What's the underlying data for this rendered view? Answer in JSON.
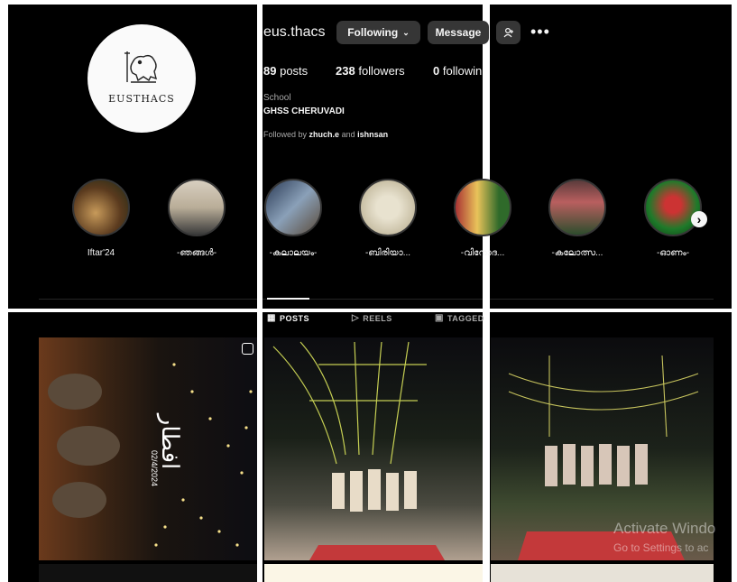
{
  "profile": {
    "username": "eus.thacs",
    "avatar_text": "EUSTHACS",
    "following_label": "Following",
    "message_label": "Message",
    "posts_count": "89",
    "posts_label": "posts",
    "followers_count": "238",
    "followers_label": "followers",
    "following_count": "0",
    "following_stat_label": "followin",
    "category": "School",
    "bio": "GHSS CHERUVADI",
    "followed_by_prefix": "Followed by",
    "followed_by_1": "zhuch.e",
    "followed_by_and": "and",
    "followed_by_2": "ishnsan"
  },
  "highlights": [
    {
      "label": "Iftar'24"
    },
    {
      "label": "-ഞങ്ങൾ-"
    },
    {
      "label": "-കലാലയം-"
    },
    {
      "label": "-ബിരിയാ..."
    },
    {
      "label": "-വിനോദ..."
    },
    {
      "label": "-കലോത്സ..."
    },
    {
      "label": "-ഓണം-"
    }
  ],
  "tabs": [
    {
      "label": "POSTS",
      "icon": "grid-icon",
      "active": true
    },
    {
      "label": "REELS",
      "icon": "reels-icon",
      "active": false
    },
    {
      "label": "TAGGED",
      "icon": "tagged-icon",
      "active": false
    }
  ],
  "posts": [
    {
      "overlay_text": "افطار",
      "date_text": "02/4/2024",
      "icon": "reel-icon"
    },
    {},
    {}
  ],
  "watermark": {
    "line1": "Activate Windo",
    "line2": "Go to Settings to ac"
  },
  "colors": {
    "background": "#000000",
    "button": "#363636",
    "text": "#f5f5f5",
    "muted": "#a8a8a8"
  }
}
